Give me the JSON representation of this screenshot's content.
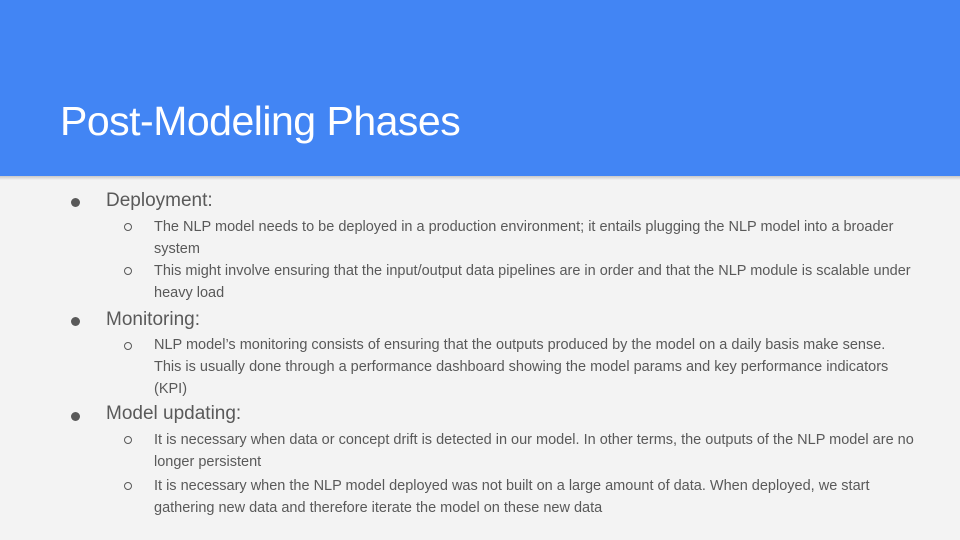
{
  "slide": {
    "title": "Post-Modeling Phases",
    "colors": {
      "header_bg": "#4285f4",
      "body_bg": "#f3f3f3",
      "text": "#595959",
      "title_text": "#ffffff"
    },
    "sections": [
      {
        "heading": "Deployment:",
        "points": [
          "The NLP model needs to be deployed in a production environment; it entails plugging the NLP model into a broader system",
          "This might involve ensuring that the input/output data pipelines are in order and that the NLP module is scalable under heavy load"
        ]
      },
      {
        "heading": "Monitoring:",
        "points": [
          "NLP model’s monitoring consists of ensuring that the outputs produced by the model on a daily basis make sense. This is usually done through a performance dashboard showing the model params and key performance indicators (KPI)"
        ]
      },
      {
        "heading": "Model updating:",
        "points": [
          "It is necessary when data or concept drift is detected in our model. In other terms, the outputs of the NLP model are no longer persistent",
          "It is necessary when the NLP model deployed was not built on a large amount of data. When deployed, we start gathering new data and therefore iterate the model on these new data"
        ]
      }
    ]
  }
}
